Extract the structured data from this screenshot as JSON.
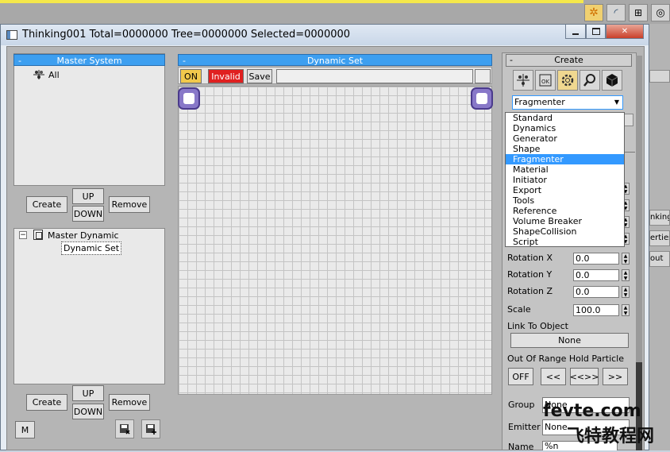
{
  "window": {
    "title": "Thinking001  Total=0000000  Tree=0000000  Selected=0000000"
  },
  "right_strip": {
    "items": [
      "nking",
      "erties",
      "out"
    ]
  },
  "master_system": {
    "header": "Master System",
    "collapse": "-",
    "tree_item": "All",
    "create": "Create",
    "up": "UP",
    "down": "DOWN",
    "remove": "Remove"
  },
  "master_dynamic": {
    "root": "Master Dynamic",
    "child": "Dynamic Set",
    "expander": "⊟",
    "create": "Create",
    "up": "UP",
    "down": "DOWN",
    "remove": "Remove",
    "m": "M"
  },
  "dynamic_set": {
    "header": "Dynamic Set",
    "collapse": "-",
    "on": "ON",
    "invalid": "Invalid",
    "save": "Save",
    "name_value": ""
  },
  "create_panel": {
    "header": "Create",
    "collapse": "-",
    "dropdown_value": "Fragmenter",
    "dropdown_options": [
      "Standard",
      "Dynamics",
      "Generator",
      "Shape",
      "Fragmenter",
      "Material",
      "Initiator",
      "Export",
      "Tools",
      "Reference",
      "Volume Breaker",
      "ShapeCollision",
      "Script"
    ],
    "selected_index": 4,
    "rotation_x_label": "Rotation X",
    "rotation_x": "0.0",
    "rotation_y_label": "Rotation Y",
    "rotation_y": "0.0",
    "rotation_z_label": "Rotation Z",
    "rotation_z": "0.0",
    "scale_label": "Scale",
    "scale": "100.0",
    "link_label": "Link To Object",
    "link_value": "None",
    "out_of_range_label": "Out Of Range Hold Particle",
    "off": "OFF",
    "prev": "<<",
    "both": "<<>>",
    "next": ">>",
    "group_label": "Group",
    "group_value": "None",
    "emitter_label": "Emitter",
    "emitter_value": "None",
    "name_label": "Name",
    "name_value": "%n"
  },
  "watermark": {
    "latin": "fevte.com",
    "cjk": "飞特教程网"
  },
  "colors": {
    "accent": "#3d9ff0",
    "on": "#f2c94c",
    "invalid": "#e02020",
    "node": "#8878c8"
  }
}
